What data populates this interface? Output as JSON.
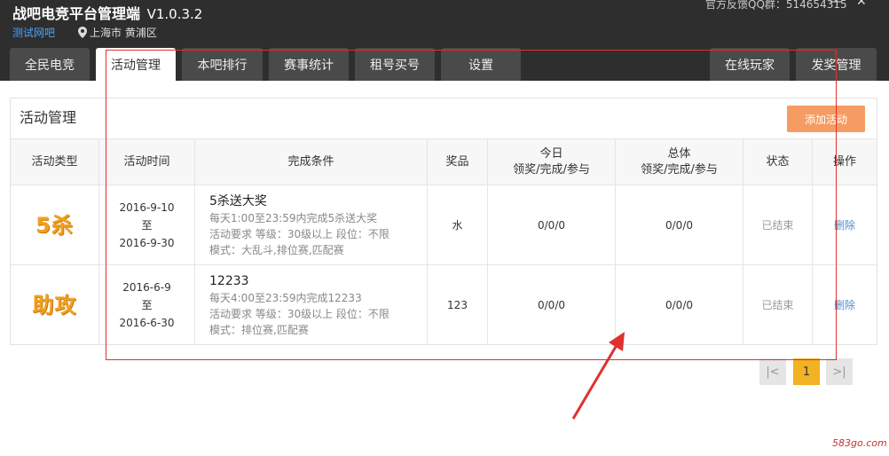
{
  "app": {
    "title": "战吧电竞平台管理端",
    "version": "V1.0.3.2",
    "cafe_name": "测试网吧",
    "location": "上海市 黄浦区",
    "feedback": "官方反馈QQ群：514654315",
    "minimize": "—",
    "close": "✕"
  },
  "tabs": [
    "全民电竞",
    "活动管理",
    "本吧排行",
    "赛事统计",
    "租号买号",
    "设置",
    "在线玩家",
    "发奖管理"
  ],
  "active_tab": "活动管理",
  "panel": {
    "title": "活动管理",
    "add_button": "添加活动"
  },
  "table": {
    "headers": {
      "type": "活动类型",
      "time": "活动时间",
      "condition": "完成条件",
      "prize": "奖品",
      "today_line1": "今日",
      "today_line2": "领奖/完成/参与",
      "total_line1": "总体",
      "total_line2": "领奖/完成/参与",
      "status": "状态",
      "action": "操作"
    },
    "rows": [
      {
        "type_logo": "5杀",
        "start": "2016-9-10",
        "to": "至",
        "end": "2016-9-30",
        "name": "5杀送大奖",
        "line1": "每天1:00至23:59内完成5杀送大奖",
        "line2": "活动要求 等级：30级以上 段位：不限",
        "line3": "模式：大乱斗,排位赛,匹配赛",
        "prize": "水",
        "today": "0/0/0",
        "total": "0/0/0",
        "status": "已结束",
        "action": "删除"
      },
      {
        "type_logo": "助攻",
        "start": "2016-6-9",
        "to": "至",
        "end": "2016-6-30",
        "name": "12233",
        "line1": "每天4:00至23:59内完成12233",
        "line2": "活动要求 等级：30级以上 段位：不限",
        "line3": "模式：排位赛,匹配赛",
        "prize": "123",
        "today": "0/0/0",
        "total": "0/0/0",
        "status": "已结束",
        "action": "删除"
      }
    ]
  },
  "pagination": {
    "first": "|<",
    "current": "1",
    "last": ">|"
  },
  "watermark": "583go.com",
  "colors": {
    "header_bg": "#2e2e2e",
    "accent_orange": "#f59c63",
    "page_active": "#f3b124",
    "link_blue": "#4a90d9",
    "annotation_red": "#e03030"
  }
}
